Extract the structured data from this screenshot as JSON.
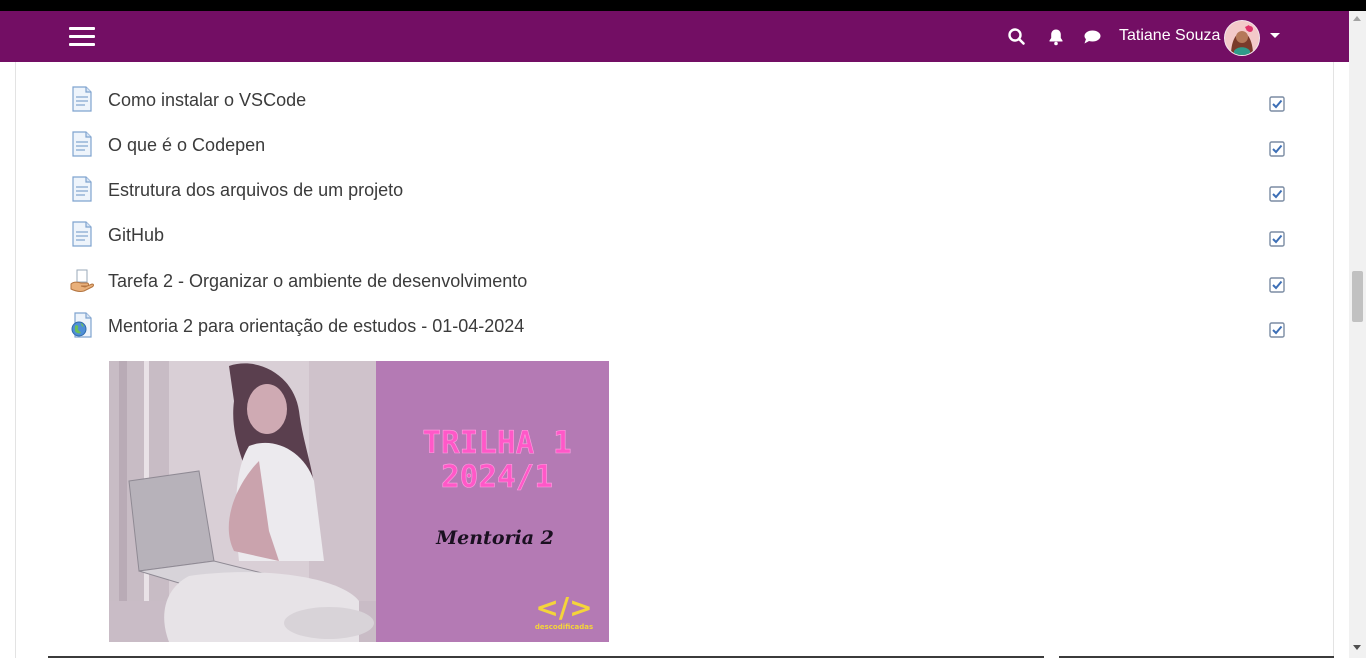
{
  "navbar": {
    "user_name": "Tatiane Souza",
    "bg_color": "#730e64",
    "icons": [
      "menu-icon",
      "search-icon",
      "bell-icon",
      "chat-icon",
      "caret-down-icon"
    ]
  },
  "activities": [
    {
      "label": "Como instalar o VSCode",
      "icon": "page-icon",
      "completed": true
    },
    {
      "label": "O que é o Codepen",
      "icon": "page-icon",
      "completed": true
    },
    {
      "label": "Estrutura dos arquivos de um projeto",
      "icon": "page-icon",
      "completed": true
    },
    {
      "label": "GitHub",
      "icon": "page-icon",
      "completed": true
    },
    {
      "label": "Tarefa 2 - Organizar o ambiente de desenvolvimento",
      "icon": "assignment-icon",
      "completed": true
    },
    {
      "label": "Mentoria 2 para orientação de estudos - 01-04-2024",
      "icon": "url-icon",
      "completed": true
    }
  ],
  "banner": {
    "title_line1": "TRILHA 1",
    "title_line2": "2024/1",
    "subtitle": "Mentoria 2",
    "logo_text": "descodificadas",
    "logo_symbol": "</>"
  }
}
